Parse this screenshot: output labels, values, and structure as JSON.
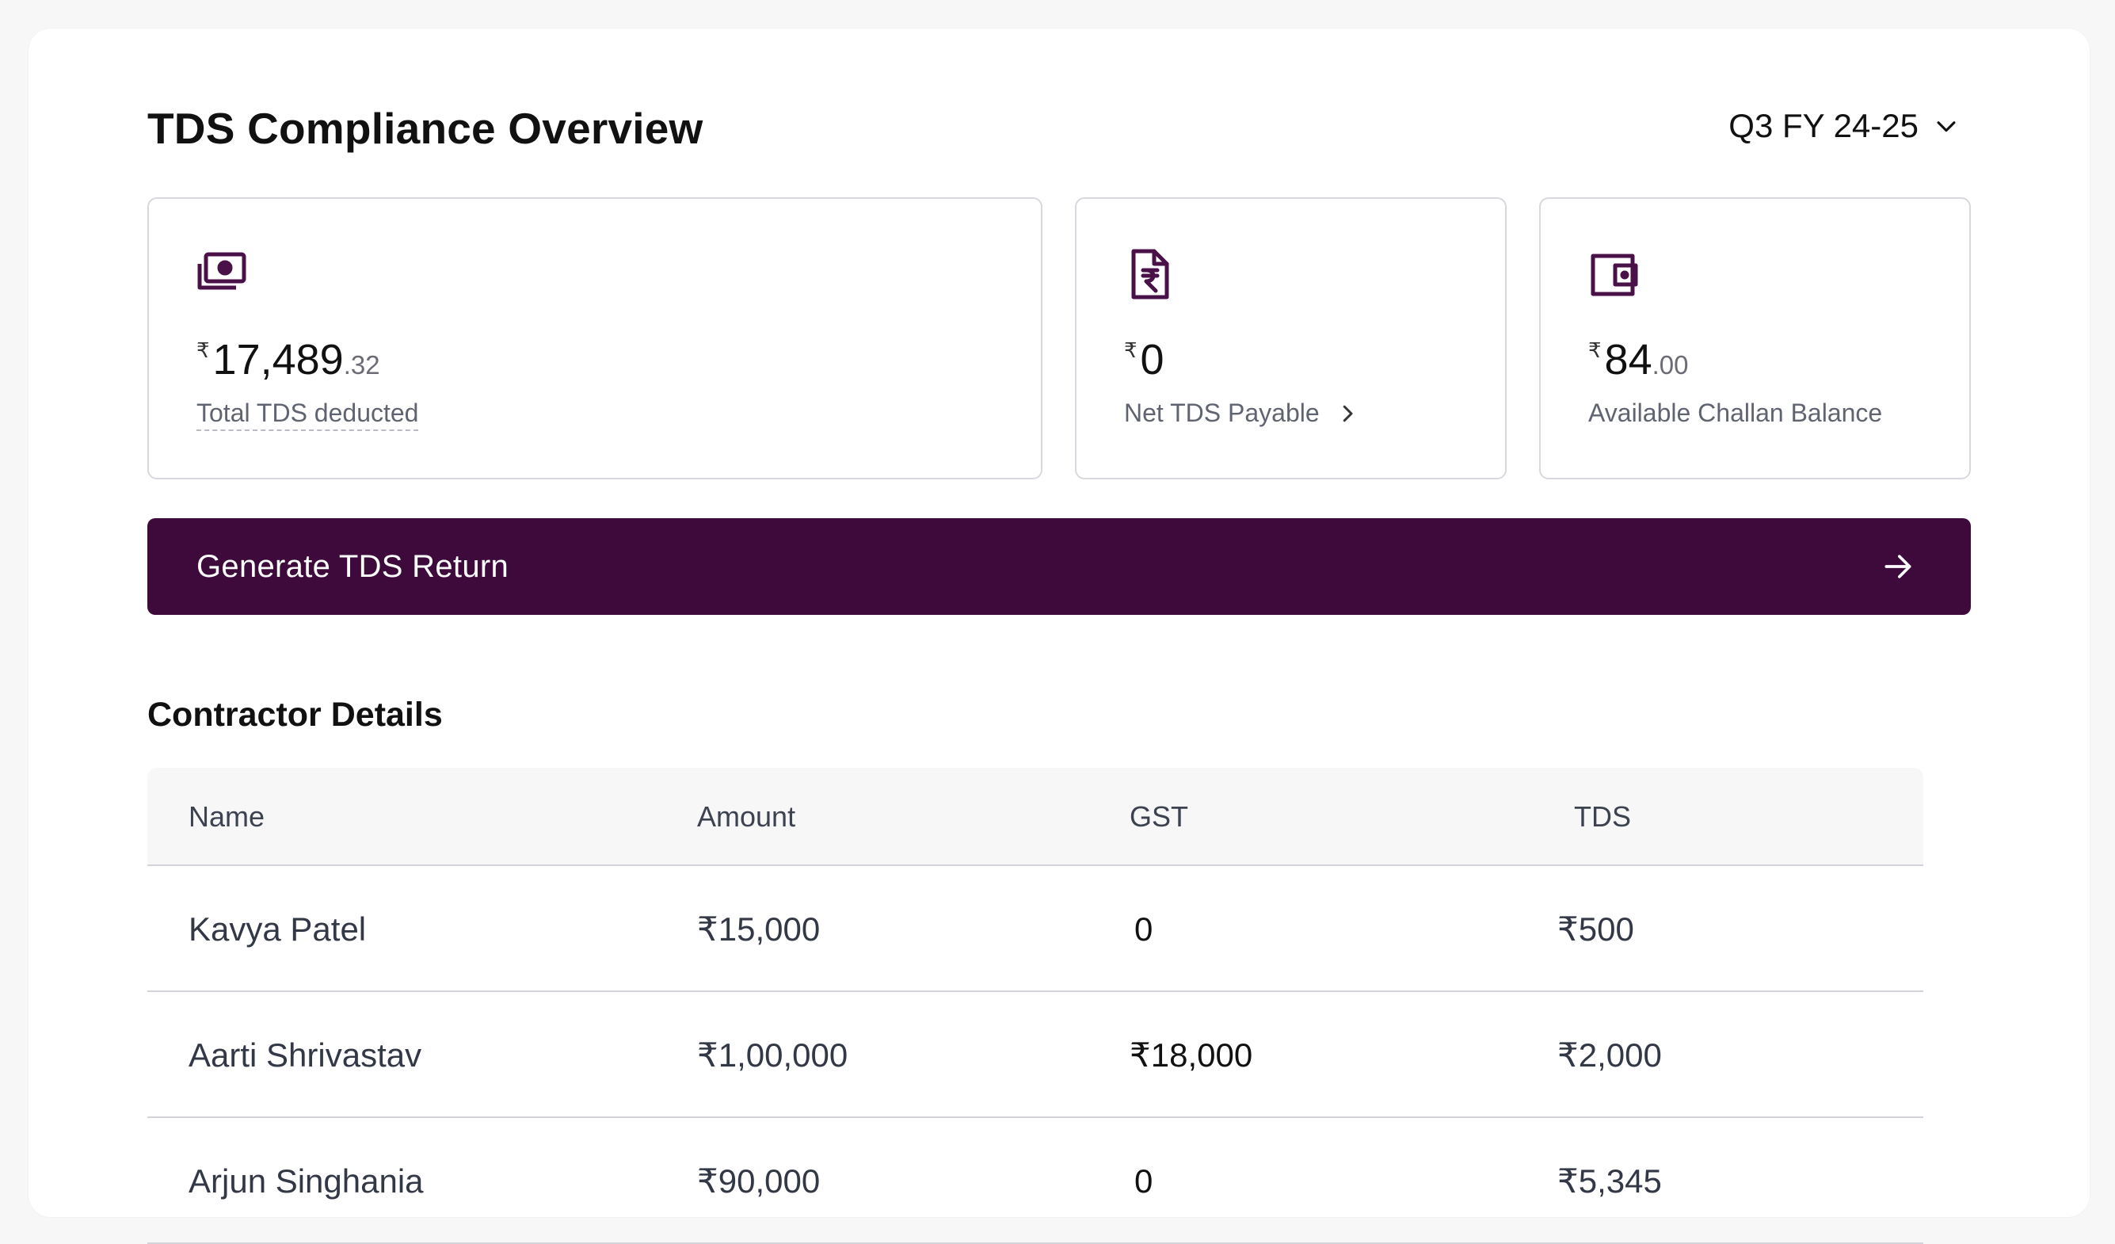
{
  "header": {
    "title": "TDS Compliance Overview",
    "period": "Q3 FY 24-25"
  },
  "cards": {
    "total": {
      "currency": "₹",
      "integer": "17,489",
      "decimal": ".32",
      "label": "Total TDS deducted",
      "icon": "cash-icon"
    },
    "net": {
      "currency": "₹",
      "integer": "0",
      "label": "Net TDS Payable",
      "icon": "rupee-document-icon"
    },
    "challan": {
      "currency": "₹",
      "integer": "84",
      "decimal": ".00",
      "label": "Available Challan Balance",
      "icon": "wallet-icon"
    }
  },
  "cta": {
    "label": "Generate TDS Return"
  },
  "contractors": {
    "title": "Contractor Details",
    "columns": [
      "Name",
      "Amount",
      "GST",
      "TDS"
    ],
    "rows": [
      [
        "Kavya Patel",
        "₹15,000",
        "0",
        "₹500"
      ],
      [
        "Aarti Shrivastav",
        "₹1,00,000",
        "₹18,000",
        "₹2,000"
      ],
      [
        "Arjun Singhania",
        "₹90,000",
        "0",
        "₹5,345"
      ]
    ]
  },
  "colors": {
    "primary": "#3e0a3b",
    "icon": "#4a1148",
    "border": "#d8d8de"
  }
}
